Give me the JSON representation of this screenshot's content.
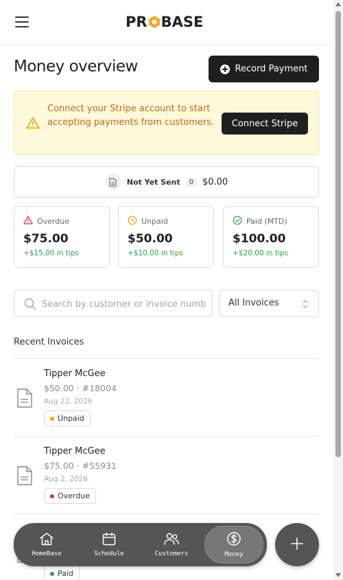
{
  "brand": {
    "logo_text_left": "PR",
    "logo_text_right": "BASE"
  },
  "header": {
    "menu_icon": "hamburger-menu-icon"
  },
  "page": {
    "title": "Money overview"
  },
  "actions": {
    "record_payment_label": "Record Payment"
  },
  "stripe_banner": {
    "message": "Connect your Stripe account to start accepting payments from customers.",
    "button_label": "Connect Stripe"
  },
  "not_yet_sent": {
    "label": "Not Yet Sent",
    "count": "0",
    "amount": "$0.00"
  },
  "stats": [
    {
      "label": "Overdue",
      "value": "$75.00",
      "tips": "+$15.00 in tips",
      "icon": "alert-triangle-icon",
      "color": "#e03131"
    },
    {
      "label": "Unpaid",
      "value": "$50.00",
      "tips": "+$10.00 in tips",
      "icon": "clock-icon",
      "color": "#f59f00"
    },
    {
      "label": "Paid (MTD)",
      "value": "$100.00",
      "tips": "+$20.00 in tips",
      "icon": "check-circle-icon",
      "color": "#2f9e44"
    }
  ],
  "filters": {
    "search_placeholder": "Search by customer or invoice number",
    "selected_filter": "All Invoices"
  },
  "recent": {
    "title": "Recent Invoices",
    "invoices": [
      {
        "customer": "Tipper McGee",
        "amount_number": "$50.00 · #18004",
        "date": "Aug 22, 2026",
        "status": "Unpaid",
        "status_color": "#f59f00"
      },
      {
        "customer": "Tipper McGee",
        "amount_number": "$75.00 · #55931",
        "date": "Aug 2, 2026",
        "status": "Overdue",
        "status_color": "#e03131"
      },
      {
        "customer": "",
        "amount_number": "",
        "date": "",
        "status": "Paid",
        "status_color": "#2f9e44"
      }
    ]
  },
  "nav": {
    "items": [
      {
        "label": "HomeBase",
        "icon": "home-icon"
      },
      {
        "label": "Schedule",
        "icon": "calendar-icon"
      },
      {
        "label": "Customers",
        "icon": "users-icon"
      },
      {
        "label": "Money",
        "icon": "dollar-circle-icon"
      }
    ],
    "active": "Money",
    "fab_icon": "plus-icon"
  },
  "colors": {
    "accent_dark": "#1f1f1f",
    "logo_hex": "#f5a623",
    "banner_bg": "#fff9db",
    "banner_text": "#c0651a",
    "nav_bg": "#555555"
  }
}
